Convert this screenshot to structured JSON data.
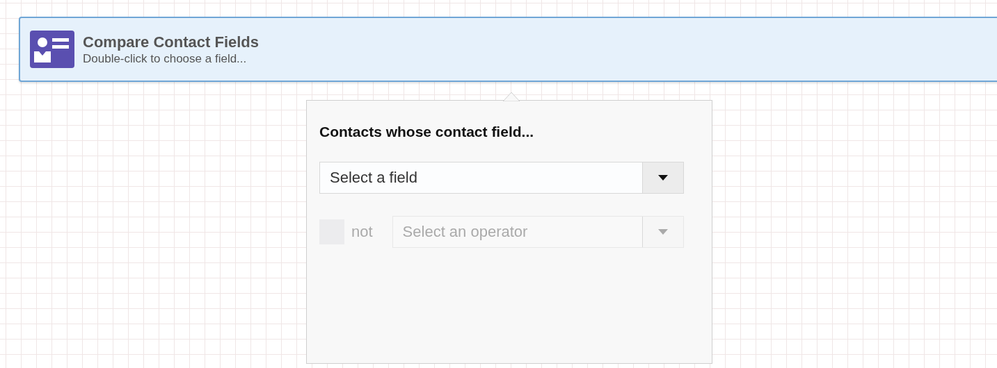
{
  "node": {
    "title": "Compare Contact Fields",
    "subtitle": "Double-click to choose a field..."
  },
  "popover": {
    "heading": "Contacts whose contact field...",
    "field_select": {
      "placeholder": "Select a field",
      "disabled": false
    },
    "negate": {
      "label": "not",
      "checked": false,
      "disabled": true
    },
    "operator_select": {
      "placeholder": "Select an operator",
      "disabled": true
    }
  }
}
